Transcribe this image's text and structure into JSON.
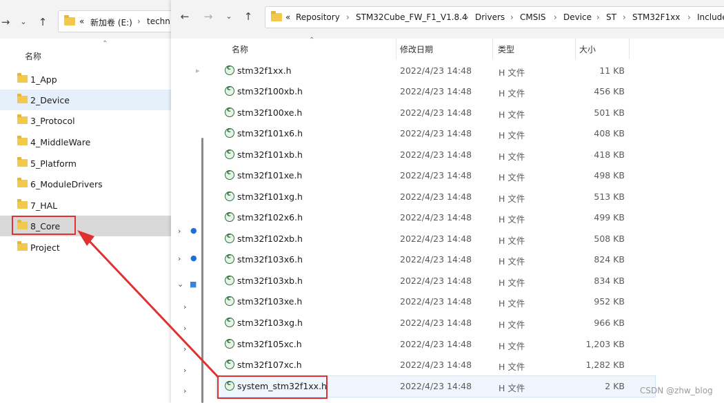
{
  "left_window": {
    "address_crumbs": [
      "«",
      "新加卷 (E:)",
      "›",
      "techni"
    ],
    "column_name": "名称",
    "folders": [
      "1_App",
      "2_Device",
      "3_Protocol",
      "4_MiddleWare",
      "5_Platform",
      "6_ModuleDrivers",
      "7_HAL",
      "8_Core",
      "Project"
    ]
  },
  "right_window": {
    "address_crumbs": [
      "«",
      "Repository",
      "›",
      "STM32Cube_FW_F1_V1.8.4",
      "›",
      "Drivers",
      "›",
      "CMSIS",
      "›",
      "Device",
      "›",
      "ST",
      "›",
      "STM32F1xx",
      "›",
      "Include"
    ],
    "columns": {
      "name": "名称",
      "date": "修改日期",
      "type": "类型",
      "size": "大小"
    },
    "files": [
      {
        "name": "stm32f1xx.h",
        "date": "2022/4/23 14:48",
        "type": "H 文件",
        "size": "11 KB"
      },
      {
        "name": "stm32f100xb.h",
        "date": "2022/4/23 14:48",
        "type": "H 文件",
        "size": "456 KB"
      },
      {
        "name": "stm32f100xe.h",
        "date": "2022/4/23 14:48",
        "type": "H 文件",
        "size": "501 KB"
      },
      {
        "name": "stm32f101x6.h",
        "date": "2022/4/23 14:48",
        "type": "H 文件",
        "size": "408 KB"
      },
      {
        "name": "stm32f101xb.h",
        "date": "2022/4/23 14:48",
        "type": "H 文件",
        "size": "418 KB"
      },
      {
        "name": "stm32f101xe.h",
        "date": "2022/4/23 14:48",
        "type": "H 文件",
        "size": "498 KB"
      },
      {
        "name": "stm32f101xg.h",
        "date": "2022/4/23 14:48",
        "type": "H 文件",
        "size": "513 KB"
      },
      {
        "name": "stm32f102x6.h",
        "date": "2022/4/23 14:48",
        "type": "H 文件",
        "size": "499 KB"
      },
      {
        "name": "stm32f102xb.h",
        "date": "2022/4/23 14:48",
        "type": "H 文件",
        "size": "508 KB"
      },
      {
        "name": "stm32f103x6.h",
        "date": "2022/4/23 14:48",
        "type": "H 文件",
        "size": "824 KB"
      },
      {
        "name": "stm32f103xb.h",
        "date": "2022/4/23 14:48",
        "type": "H 文件",
        "size": "834 KB"
      },
      {
        "name": "stm32f103xe.h",
        "date": "2022/4/23 14:48",
        "type": "H 文件",
        "size": "952 KB"
      },
      {
        "name": "stm32f103xg.h",
        "date": "2022/4/23 14:48",
        "type": "H 文件",
        "size": "966 KB"
      },
      {
        "name": "stm32f105xc.h",
        "date": "2022/4/23 14:48",
        "type": "H 文件",
        "size": "1,203 KB"
      },
      {
        "name": "stm32f107xc.h",
        "date": "2022/4/23 14:48",
        "type": "H 文件",
        "size": "1,282 KB"
      },
      {
        "name": "system_stm32f1xx.h",
        "date": "2022/4/23 14:48",
        "type": "H 文件",
        "size": "2 KB"
      }
    ]
  },
  "watermark": "CSDN @zhw_blog",
  "colors": {
    "annotation": "#e03131",
    "folder": "#f2c94c",
    "hover": "#e5f0fb",
    "selected": "#d9d9d9"
  }
}
